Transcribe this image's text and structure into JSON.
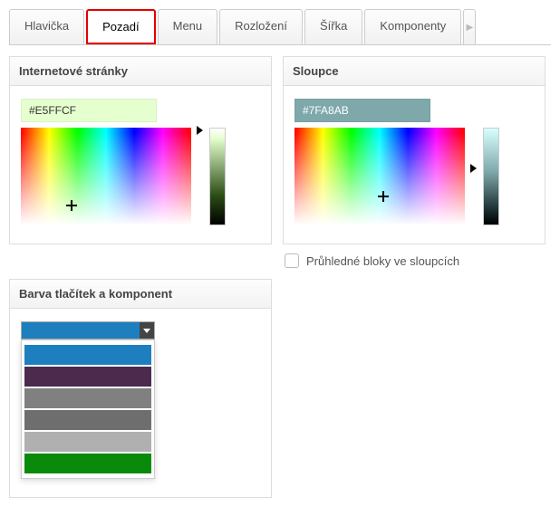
{
  "tabs": {
    "items": [
      "Hlavička",
      "Pozadí",
      "Menu",
      "Rozložení",
      "Šířka",
      "Komponenty"
    ],
    "activeIndex": 1
  },
  "panelWeb": {
    "title": "Internetové stránky",
    "value": "#E5FFCF"
  },
  "panelCol": {
    "title": "Sloupce",
    "value": "#7FA8AB"
  },
  "transparent": {
    "label": "Průhledné bloky ve sloupcích",
    "checked": false
  },
  "panelButtons": {
    "title": "Barva tlačítek a komponent",
    "current": "#1d7fbd",
    "options": [
      "#1d7fbd",
      "#4b2a4d",
      "#808080",
      "#6e6e6e",
      "#b0b0b0",
      "#0a8a0a"
    ]
  }
}
